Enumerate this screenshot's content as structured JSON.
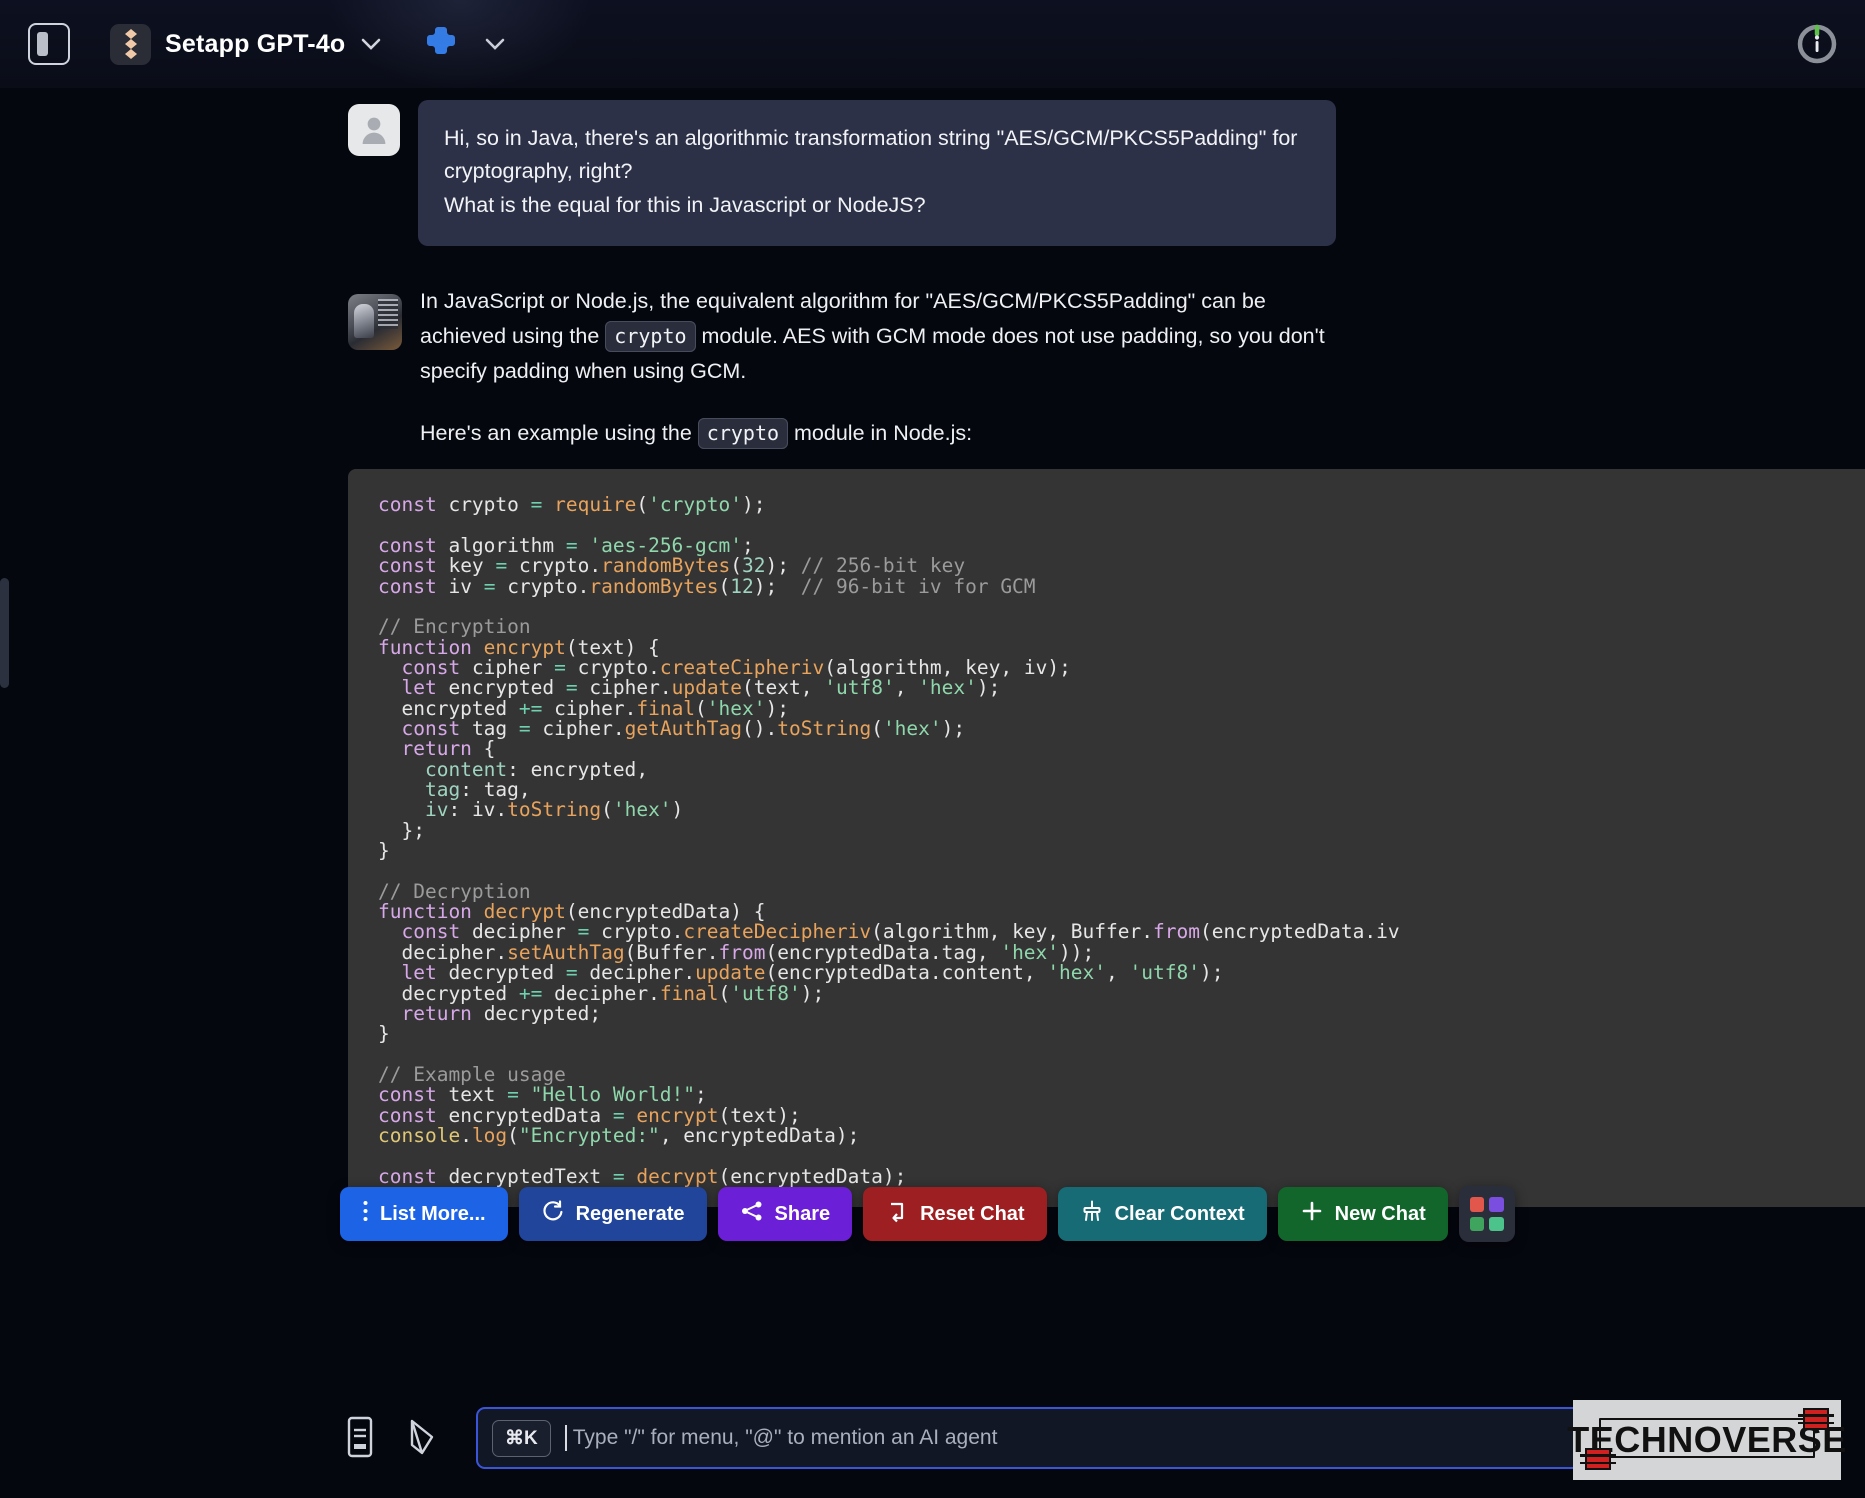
{
  "topbar": {
    "sidebar_toggle_name": "sidebar-toggle-icon",
    "model_name": "Setapp GPT-4o",
    "model_chevron": "⌄",
    "plugin_icon": "puzzle-piece-icon",
    "plugin_chevron": "⌄",
    "info_icon": "info-icon"
  },
  "conversation": {
    "user": {
      "line1": "Hi, so in Java, there's an algorithmic transformation string \"AES/GCM/PKCS5Padding\" for cryptography, right?",
      "line2": "What is the equal for this in Javascript or NodeJS?"
    },
    "assistant": {
      "para1_a": "In JavaScript or Node.js, the equivalent algorithm for \"AES/GCM/PKCS5Padding\" can be achieved using the ",
      "para1_code": "crypto",
      "para1_b": " module. AES with GCM mode does not use padding, so you don't specify padding when using GCM.",
      "para2_a": "Here's an example using the ",
      "para2_code": "crypto",
      "para2_b": " module in Node.js:",
      "code_language": "javascript"
    }
  },
  "toolbar": {
    "buttons": [
      {
        "label": "List More...",
        "icon": "vertical-dots-icon",
        "color": "#1d63e6"
      },
      {
        "label": "Regenerate",
        "icon": "refresh-icon",
        "color": "#20459b"
      },
      {
        "label": "Share",
        "icon": "share-nodes-icon",
        "color": "#6b1fd6"
      },
      {
        "label": "Reset Chat",
        "icon": "reset-arrow-icon",
        "color": "#9e1f22"
      },
      {
        "label": "Clear Context",
        "icon": "broom-icon",
        "color": "#166b75"
      },
      {
        "label": "New Chat",
        "icon": "plus-icon",
        "color": "#12662c"
      }
    ],
    "grid_button_name": "app-grid-button",
    "grid_colors": [
      "#e2574c",
      "#7a4fe0",
      "#3fa55e",
      "#4cc38a"
    ]
  },
  "input": {
    "shortcut": "⌘K",
    "placeholder": "Type \"/\" for menu, \"@\" to mention an AI agent",
    "value": "",
    "left_icons": [
      "notes-icon",
      "pen-nib-icon"
    ],
    "right_icons": [
      "paperclip-icon",
      "microphone-icon"
    ]
  },
  "watermark": {
    "text": "TECHNOVERSE"
  },
  "colors": {
    "app_bg": "#05070f",
    "user_bubble": "#2c3147",
    "code_bg": "#343434",
    "accent_blue": "#3b55d9"
  }
}
